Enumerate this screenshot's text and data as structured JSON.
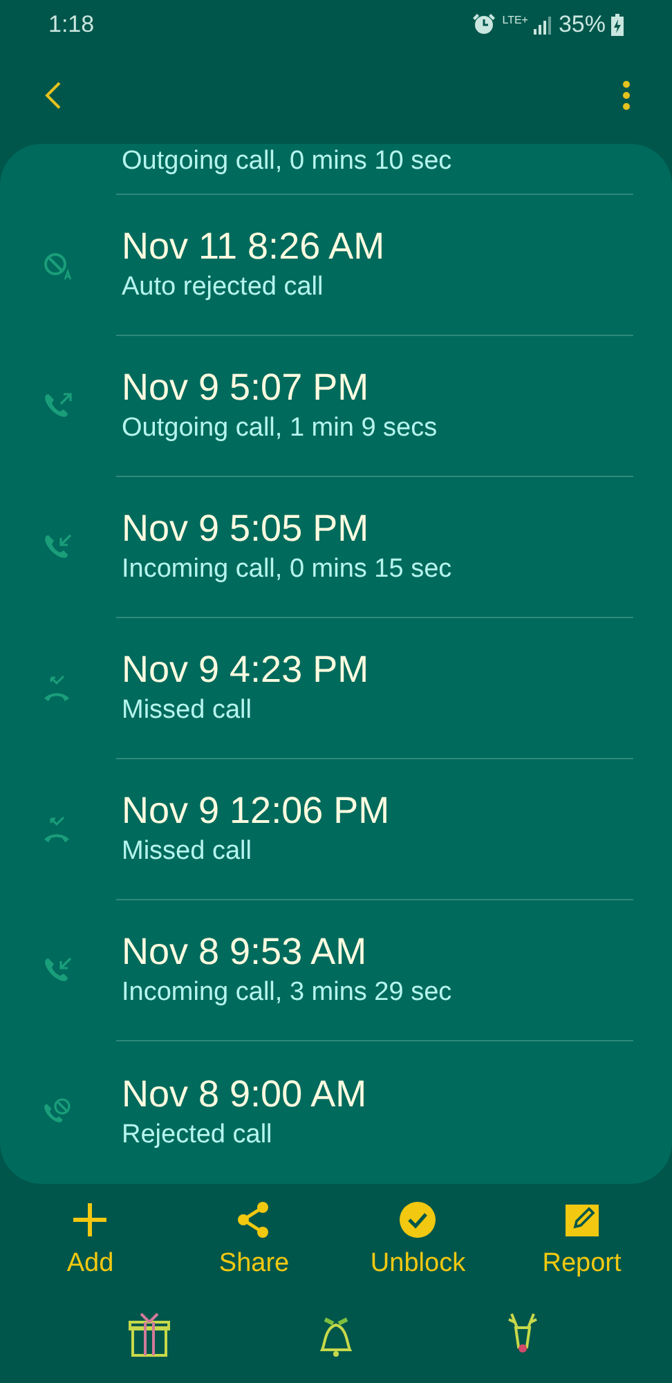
{
  "status_bar": {
    "time": "1:18",
    "network": "LTE+",
    "battery": "35%"
  },
  "partial_row": {
    "detail": "Outgoing call, 0 mins 10 sec"
  },
  "calls": [
    {
      "kind": "auto_rejected",
      "time": "Nov 11 8:26 AM",
      "detail": "Auto rejected call"
    },
    {
      "kind": "outgoing",
      "time": "Nov 9 5:07 PM",
      "detail": "Outgoing call, 1 min 9 secs"
    },
    {
      "kind": "incoming",
      "time": "Nov 9 5:05 PM",
      "detail": "Incoming call, 0 mins 15 sec"
    },
    {
      "kind": "missed",
      "time": "Nov 9 4:23 PM",
      "detail": "Missed call"
    },
    {
      "kind": "missed",
      "time": "Nov 9 12:06 PM",
      "detail": "Missed call"
    },
    {
      "kind": "incoming",
      "time": "Nov 8 9:53 AM",
      "detail": "Incoming call, 3 mins 29 sec"
    },
    {
      "kind": "rejected",
      "time": "Nov 8 9:00 AM",
      "detail": "Rejected call"
    }
  ],
  "actions": [
    {
      "kind": "add",
      "label": "Add"
    },
    {
      "kind": "share",
      "label": "Share"
    },
    {
      "kind": "unblock",
      "label": "Unblock"
    },
    {
      "kind": "report",
      "label": "Report"
    }
  ],
  "nav_buttons": [
    {
      "kind": "gift"
    },
    {
      "kind": "bell"
    },
    {
      "kind": "reindeer"
    }
  ]
}
